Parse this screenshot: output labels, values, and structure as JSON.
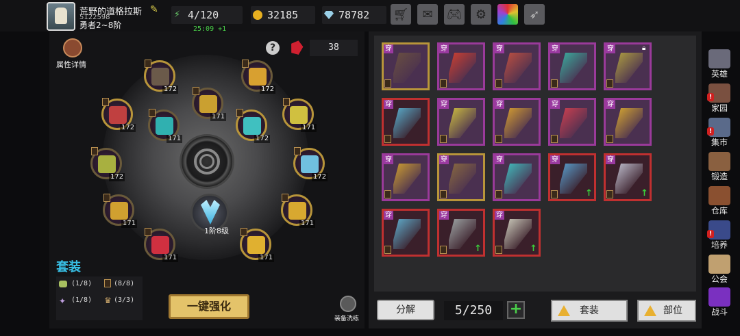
{
  "player": {
    "name": "荒野的道格拉斯",
    "id": "5122598",
    "rank": "勇者2~8阶"
  },
  "resources": {
    "energy": "4/120",
    "gold": "32185",
    "gems": "78782",
    "timer": "25:09 +1"
  },
  "toolbar_icons": [
    "shop-cart-icon",
    "mail-icon",
    "gamepad-icon",
    "gear-icon",
    "color-wheel-icon",
    "feather-icon"
  ],
  "left": {
    "attr_label": "属性详情",
    "gem_count": "38",
    "center_label": "1阶8级",
    "set_title": "套装",
    "set_rows": [
      {
        "a": "(1/8)",
        "b": "(8/8)"
      },
      {
        "a": "(1/8)",
        "b": "(3/3)"
      }
    ],
    "enhance_label": "一键强化",
    "wash_label": "装备洗练",
    "slots": [
      {
        "level": "172",
        "color": "#6b5a4a"
      },
      {
        "level": "172",
        "color": "#d8a030"
      },
      {
        "level": "172",
        "color": "#c04040"
      },
      {
        "level": "171",
        "color": "#caa030"
      },
      {
        "level": "171",
        "color": "#d0c040"
      },
      {
        "level": "171",
        "color": "#30b0b0"
      },
      {
        "level": "172",
        "color": "#40c0c0"
      },
      {
        "level": "172",
        "color": "#a8b040"
      },
      {
        "level": "172",
        "color": "#70c0e0"
      },
      {
        "level": "171",
        "color": "#d0a030"
      },
      {
        "level": "171",
        "color": "#d8a830"
      },
      {
        "level": "171",
        "color": "#d03040"
      },
      {
        "level": "171",
        "color": "#e0b030"
      }
    ]
  },
  "inventory": {
    "wear_label": "穿",
    "capacity": "5/250",
    "decompose_label": "分解",
    "sort_set_label": "套装",
    "sort_part_label": "部位",
    "items": [
      {
        "rarity": "gold",
        "color": "#6a5040",
        "lock": false,
        "up": false
      },
      {
        "rarity": "purple",
        "color": "#d04030",
        "lock": false,
        "up": false
      },
      {
        "rarity": "purple",
        "color": "#c05040",
        "lock": false,
        "up": false
      },
      {
        "rarity": "purple",
        "color": "#3ab0a0",
        "lock": false,
        "up": false
      },
      {
        "rarity": "purple",
        "color": "#b0a040",
        "lock": true,
        "up": false
      },
      {
        "rarity": "red",
        "color": "#5ab0d0",
        "lock": false,
        "up": false
      },
      {
        "rarity": "purple",
        "color": "#d0c040",
        "lock": false,
        "up": false
      },
      {
        "rarity": "purple",
        "color": "#d8a030",
        "lock": false,
        "up": false
      },
      {
        "rarity": "purple",
        "color": "#d04050",
        "lock": false,
        "up": false
      },
      {
        "rarity": "purple",
        "color": "#d8a830",
        "lock": false,
        "up": false
      },
      {
        "rarity": "purple",
        "color": "#d0a030",
        "lock": false,
        "up": false
      },
      {
        "rarity": "gold",
        "color": "#8a6a40",
        "lock": false,
        "up": false
      },
      {
        "rarity": "purple",
        "color": "#40c0c0",
        "lock": false,
        "up": false
      },
      {
        "rarity": "red",
        "color": "#5aa0d0",
        "lock": false,
        "up": true
      },
      {
        "rarity": "red",
        "color": "#c0c0d0",
        "lock": false,
        "up": true
      },
      {
        "rarity": "red",
        "color": "#60b0d0",
        "lock": false,
        "up": false
      },
      {
        "rarity": "red",
        "color": "#a0a8a8",
        "lock": false,
        "up": true
      },
      {
        "rarity": "red",
        "color": "#d0d0c0",
        "lock": false,
        "up": true
      }
    ]
  },
  "nav": [
    {
      "label": "英雄",
      "icon": "helmet-icon",
      "alert": false,
      "color": "#6a6a7a"
    },
    {
      "label": "家园",
      "icon": "house-icon",
      "alert": true,
      "color": "#7a5040"
    },
    {
      "label": "集市",
      "icon": "market-icon",
      "alert": true,
      "color": "#5a6a8a"
    },
    {
      "label": "锻造",
      "icon": "anvil-icon",
      "alert": false,
      "color": "#8a6040"
    },
    {
      "label": "仓库",
      "icon": "warehouse-icon",
      "alert": false,
      "color": "#8a5030"
    },
    {
      "label": "培养",
      "icon": "wizard-icon",
      "alert": true,
      "color": "#3a4a8a"
    },
    {
      "label": "公会",
      "icon": "guild-icon",
      "alert": false,
      "color": "#c0a070"
    },
    {
      "label": "战斗",
      "icon": "portal-icon",
      "alert": false,
      "color": "#7a30c0"
    }
  ]
}
